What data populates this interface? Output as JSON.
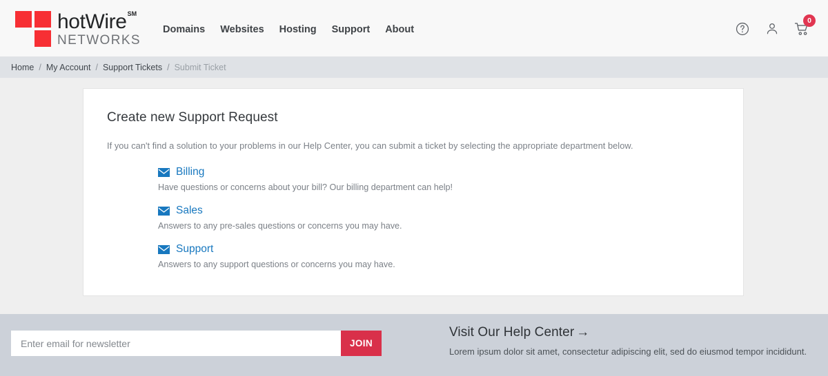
{
  "header": {
    "logo": {
      "word": "hotWire",
      "sm": "SM",
      "subtitle": "NETWORKS",
      "squares_icon": "logo-squares-icon"
    },
    "nav": [
      {
        "label": "Domains"
      },
      {
        "label": "Websites"
      },
      {
        "label": "Hosting"
      },
      {
        "label": "Support"
      },
      {
        "label": "About"
      }
    ],
    "icons": {
      "help": "help-circle-icon",
      "account": "user-icon",
      "cart": "shopping-cart-icon",
      "cart_count": "0"
    }
  },
  "breadcrumb": {
    "separator": "/",
    "items": [
      {
        "label": "Home",
        "current": false
      },
      {
        "label": "My Account",
        "current": false
      },
      {
        "label": "Support Tickets",
        "current": false
      },
      {
        "label": "Submit Ticket",
        "current": true
      }
    ]
  },
  "card": {
    "title": "Create new Support Request",
    "intro": "If you can't find a solution to your problems in our Help Center, you can submit a ticket by selecting the appropriate department below.",
    "departments": [
      {
        "icon": "envelope-icon",
        "name": "Billing",
        "description": "Have questions or concerns about your bill? Our billing department can help!"
      },
      {
        "icon": "envelope-icon",
        "name": "Sales",
        "description": "Answers to any pre-sales questions or concerns you may have."
      },
      {
        "icon": "envelope-icon",
        "name": "Support",
        "description": "Answers to any support questions or concerns you may have."
      }
    ]
  },
  "footer": {
    "newsletter": {
      "placeholder": "Enter email for newsletter",
      "value": "",
      "button_label": "JOIN"
    },
    "help_center": {
      "title": "Visit Our Help Center",
      "arrow": "→",
      "subtitle": "Lorem ipsum dolor sit amet, consectetur adipiscing elit, sed do eiusmod tempor incididunt."
    }
  },
  "colors": {
    "brand_red": "#f72f34",
    "accent_blue": "#1878bf",
    "join_red": "#d9304a",
    "badge_red": "#e13651",
    "page_bg": "#efefef",
    "footer_bg": "#ccd1d9",
    "breadcrumb_bg": "#dfe2e6",
    "header_bg": "#f8f8f8"
  }
}
